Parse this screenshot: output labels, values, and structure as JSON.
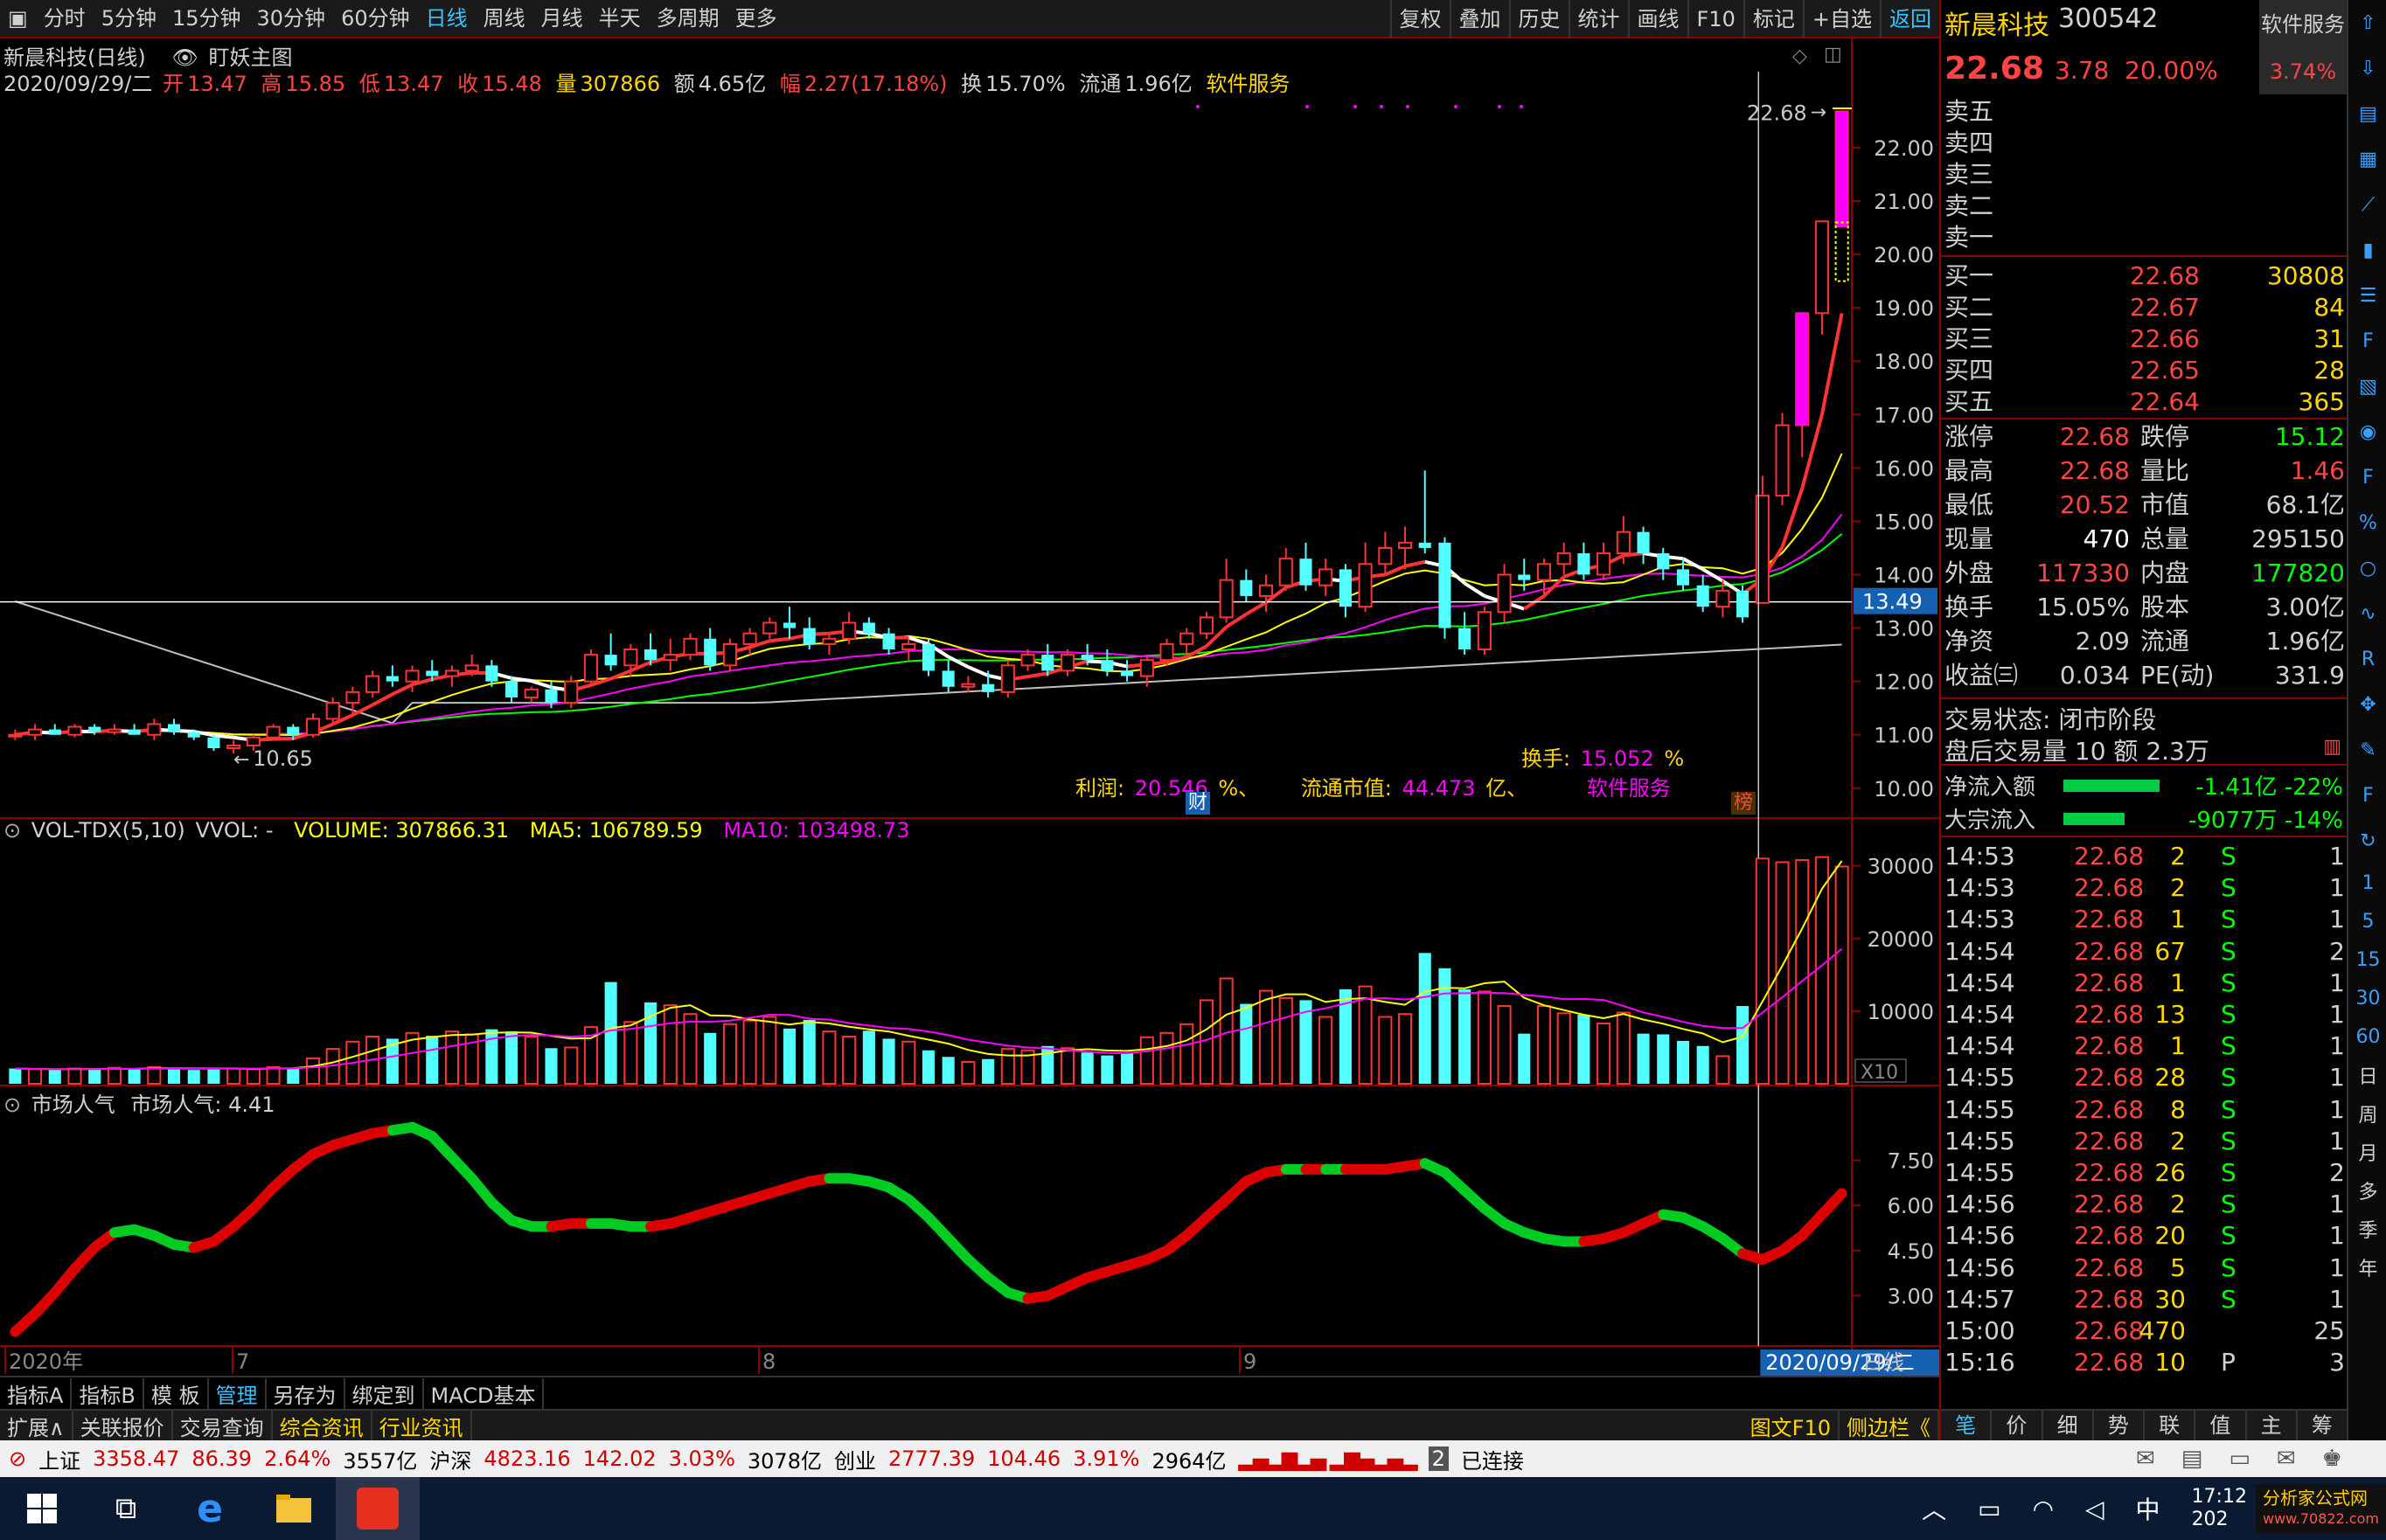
{
  "toolbar": {
    "left_items": [
      "分时",
      "5分钟",
      "15分钟",
      "30分钟",
      "60分钟",
      "日线",
      "周线",
      "月线",
      "半天",
      "多周期",
      "更多"
    ],
    "active": "日线",
    "right_items": [
      "复权",
      "叠加",
      "历史",
      "统计",
      "画线",
      "F10",
      "标记",
      "+自选",
      "返回"
    ]
  },
  "chart": {
    "title": "新晨科技(日线)",
    "indicator_name": "盯妖主图",
    "date_line": "2020/09/29/二",
    "open_label": "开",
    "open": "13.47",
    "high_label": "高",
    "high": "15.85",
    "low_label": "低",
    "low": "13.47",
    "close_label": "收",
    "close": "15.48",
    "vol_label": "量",
    "vol": "307866",
    "amt_label": "额",
    "amt": "4.65亿",
    "range_label": "幅",
    "range": "2.27(17.18%)",
    "turnover_label": "换",
    "turnover": "15.70%",
    "float_label": "流通",
    "float": "1.96亿",
    "sector": "软件服务",
    "price_peak": "22.68",
    "price_low_marker": "10.65",
    "current_line_label": "13.49",
    "y_ticks": [
      "22.00",
      "21.00",
      "20.00",
      "19.00",
      "18.00",
      "17.00",
      "16.00",
      "15.00",
      "14.00",
      "13.00",
      "12.00",
      "11.00",
      "10.00"
    ],
    "bottom_text": {
      "turnover_label": "换手:",
      "turnover_val": "15.052",
      "turnover_unit": "%",
      "profit_label": "利润:",
      "profit_val": "20.546",
      "profit_unit": "%、",
      "mktcap_label": "流通市值:",
      "mktcap_val": "44.473",
      "mktcap_unit": "亿、",
      "sector": "软件服务",
      "cai": "财",
      "bang": "榜"
    }
  },
  "vol_panel": {
    "name": "VOL-TDX(5,10)",
    "vvol": "VVOL: -",
    "volume": "VOLUME: 307866.31",
    "ma5": "MA5: 106789.59",
    "ma10": "MA10: 103498.73",
    "y_ticks": [
      "30000",
      "20000",
      "10000"
    ],
    "x10": "X10"
  },
  "sentiment_panel": {
    "name": "市场人气",
    "value": "市场人气: 4.41",
    "y_ticks": [
      "7.50",
      "6.00",
      "4.50",
      "3.00"
    ]
  },
  "x_axis": {
    "labels": [
      "2020年",
      "7",
      "8",
      "9"
    ],
    "cursor_date": "2020/09/29/二",
    "period": "日线"
  },
  "right_panel": {
    "stock_name": "新晨科技",
    "code": "300542",
    "sector_btn": "软件服务",
    "sector_pct": "3.74%",
    "price": "22.68",
    "change": "3.78",
    "change_pct": "20.00%",
    "sell": [
      {
        "label": "卖五",
        "price": "",
        "vol": ""
      },
      {
        "label": "卖四",
        "price": "",
        "vol": ""
      },
      {
        "label": "卖三",
        "price": "",
        "vol": ""
      },
      {
        "label": "卖二",
        "price": "",
        "vol": ""
      },
      {
        "label": "卖一",
        "price": "",
        "vol": ""
      }
    ],
    "buy": [
      {
        "label": "买一",
        "price": "22.68",
        "vol": "30808"
      },
      {
        "label": "买二",
        "price": "22.67",
        "vol": "84"
      },
      {
        "label": "买三",
        "price": "22.66",
        "vol": "31"
      },
      {
        "label": "买四",
        "price": "22.65",
        "vol": "28"
      },
      {
        "label": "买五",
        "price": "22.64",
        "vol": "365"
      }
    ],
    "stats": [
      {
        "l1": "涨停",
        "v1": "22.68",
        "l2": "跌停",
        "v2": "15.12",
        "c1": "#ff4444",
        "c2": "#00ff00"
      },
      {
        "l1": "最高",
        "v1": "22.68",
        "l2": "量比",
        "v2": "1.46",
        "c1": "#ff4444",
        "c2": "#ff4444"
      },
      {
        "l1": "最低",
        "v1": "20.52",
        "l2": "市值",
        "v2": "68.1亿",
        "c1": "#ff4444",
        "c2": "#d0d0d0"
      },
      {
        "l1": "现量",
        "v1": "470",
        "l2": "总量",
        "v2": "295150",
        "c1": "#ffffff",
        "c2": "#d0d0d0"
      },
      {
        "l1": "外盘",
        "v1": "117330",
        "l2": "内盘",
        "v2": "177820",
        "c1": "#ff4444",
        "c2": "#00ff00"
      },
      {
        "l1": "换手",
        "v1": "15.05%",
        "l2": "股本",
        "v2": "3.00亿",
        "c1": "#d0d0d0",
        "c2": "#d0d0d0"
      },
      {
        "l1": "净资",
        "v1": "2.09",
        "l2": "流通",
        "v2": "1.96亿",
        "c1": "#d0d0d0",
        "c2": "#d0d0d0"
      },
      {
        "l1": "收益㈢",
        "v1": "0.034",
        "l2": "PE(动)",
        "v2": "331.9",
        "c1": "#d0d0d0",
        "c2": "#d0d0d0"
      }
    ],
    "trade_state": "交易状态: 闭市阶段",
    "after_hours": "盘后交易量 10 额 2.3万",
    "net_inflow_label": "净流入额",
    "net_inflow_val": "-1.41亿 -22%",
    "block_inflow_label": "大宗流入",
    "block_inflow_val": "-9077万 -14%",
    "ticks": [
      {
        "t": "14:53",
        "p": "22.68",
        "v": "2",
        "s": "S",
        "n": "1"
      },
      {
        "t": "14:53",
        "p": "22.68",
        "v": "2",
        "s": "S",
        "n": "1"
      },
      {
        "t": "14:53",
        "p": "22.68",
        "v": "1",
        "s": "S",
        "n": "1"
      },
      {
        "t": "14:54",
        "p": "22.68",
        "v": "67",
        "s": "S",
        "n": "2"
      },
      {
        "t": "14:54",
        "p": "22.68",
        "v": "1",
        "s": "S",
        "n": "1"
      },
      {
        "t": "14:54",
        "p": "22.68",
        "v": "13",
        "s": "S",
        "n": "1"
      },
      {
        "t": "14:54",
        "p": "22.68",
        "v": "1",
        "s": "S",
        "n": "1"
      },
      {
        "t": "14:55",
        "p": "22.68",
        "v": "28",
        "s": "S",
        "n": "1"
      },
      {
        "t": "14:55",
        "p": "22.68",
        "v": "8",
        "s": "S",
        "n": "1"
      },
      {
        "t": "14:55",
        "p": "22.68",
        "v": "2",
        "s": "S",
        "n": "1"
      },
      {
        "t": "14:55",
        "p": "22.68",
        "v": "26",
        "s": "S",
        "n": "2"
      },
      {
        "t": "14:56",
        "p": "22.68",
        "v": "2",
        "s": "S",
        "n": "1"
      },
      {
        "t": "14:56",
        "p": "22.68",
        "v": "20",
        "s": "S",
        "n": "1"
      },
      {
        "t": "14:56",
        "p": "22.68",
        "v": "5",
        "s": "S",
        "n": "1"
      },
      {
        "t": "14:57",
        "p": "22.68",
        "v": "30",
        "s": "S",
        "n": "1"
      },
      {
        "t": "15:00",
        "p": "22.68",
        "v": "470",
        "s": "",
        "n": "25"
      },
      {
        "t": "15:16",
        "p": "22.68",
        "v": "10",
        "s": "P",
        "n": "3"
      }
    ],
    "bottom_tabs": [
      "笔",
      "价",
      "细",
      "势",
      "联",
      "值",
      "主",
      "筹"
    ]
  },
  "side_icons_text": [
    "1",
    "5",
    "15",
    "30",
    "60",
    "日",
    "周",
    "月",
    "多",
    "季",
    "年"
  ],
  "bottom_tabs1": [
    "指标A",
    "指标B",
    "模 板",
    "管理",
    "另存为",
    "绑定到",
    "MACD基本"
  ],
  "bottom_tabs1_active": "管理",
  "bottom_tabs2": [
    "扩展∧",
    "关联报价",
    "交易查询",
    "综合资讯",
    "行业资讯"
  ],
  "bottom_tabs2_right": [
    "图文F10",
    "侧边栏《"
  ],
  "status_bar": {
    "sh_label": "上证",
    "sh_val": "3358.47",
    "sh_chg": "86.39",
    "sh_pct": "2.64%",
    "sh_amt": "3557亿",
    "hs_label": "沪深",
    "hs_val": "4823.16",
    "hs_chg": "142.02",
    "hs_pct": "3.03%",
    "hs_amt": "3078亿",
    "cy_label": "创业",
    "cy_val": "2777.39",
    "cy_chg": "104.46",
    "cy_pct": "3.91%",
    "cy_amt": "2964亿",
    "conn_num": "2",
    "connected": "已连接"
  },
  "taskbar": {
    "clock_time": "17:12",
    "clock_date": "202",
    "watermark": "分析家公式网",
    "watermark_url": "www.70822.com"
  },
  "chart_data": {
    "type": "candlestick",
    "candles": [
      [
        11.0,
        11.1,
        10.9,
        11.0
      ],
      [
        11.0,
        11.2,
        10.9,
        11.1
      ],
      [
        11.1,
        11.2,
        11.0,
        11.0
      ],
      [
        11.0,
        11.2,
        10.95,
        11.15
      ],
      [
        11.15,
        11.2,
        11.0,
        11.05
      ],
      [
        11.05,
        11.2,
        11.0,
        11.1
      ],
      [
        11.1,
        11.2,
        11.0,
        11.0
      ],
      [
        11.0,
        11.3,
        10.9,
        11.2
      ],
      [
        11.2,
        11.3,
        11.0,
        11.05
      ],
      [
        11.05,
        11.1,
        10.9,
        10.95
      ],
      [
        10.95,
        11.0,
        10.7,
        10.75
      ],
      [
        10.75,
        10.9,
        10.65,
        10.8
      ],
      [
        10.8,
        11.0,
        10.7,
        10.95
      ],
      [
        10.95,
        11.2,
        10.9,
        11.15
      ],
      [
        11.15,
        11.2,
        10.9,
        11.0
      ],
      [
        11.0,
        11.4,
        10.95,
        11.3
      ],
      [
        11.3,
        11.7,
        11.2,
        11.6
      ],
      [
        11.6,
        11.9,
        11.4,
        11.8
      ],
      [
        11.8,
        12.2,
        11.7,
        12.1
      ],
      [
        12.1,
        12.3,
        11.9,
        12.0
      ],
      [
        12.0,
        12.3,
        11.8,
        12.2
      ],
      [
        12.2,
        12.4,
        12.0,
        12.1
      ],
      [
        12.1,
        12.3,
        11.9,
        12.2
      ],
      [
        12.2,
        12.5,
        12.1,
        12.3
      ],
      [
        12.3,
        12.4,
        11.9,
        12.0
      ],
      [
        12.0,
        12.1,
        11.6,
        11.7
      ],
      [
        11.7,
        11.9,
        11.6,
        11.85
      ],
      [
        11.85,
        12.0,
        11.5,
        11.6
      ],
      [
        11.6,
        12.1,
        11.5,
        12.0
      ],
      [
        12.0,
        12.6,
        11.9,
        12.5
      ],
      [
        12.5,
        12.9,
        12.2,
        12.3
      ],
      [
        12.3,
        12.7,
        12.1,
        12.6
      ],
      [
        12.6,
        12.9,
        12.3,
        12.4
      ],
      [
        12.4,
        12.8,
        12.2,
        12.5
      ],
      [
        12.5,
        12.9,
        12.4,
        12.8
      ],
      [
        12.8,
        13.0,
        12.2,
        12.3
      ],
      [
        12.3,
        12.8,
        12.2,
        12.7
      ],
      [
        12.7,
        13.0,
        12.5,
        12.9
      ],
      [
        12.9,
        13.2,
        12.8,
        13.1
      ],
      [
        13.1,
        13.4,
        12.8,
        13.0
      ],
      [
        13.0,
        13.2,
        12.6,
        12.7
      ],
      [
        12.7,
        12.9,
        12.5,
        12.8
      ],
      [
        12.8,
        13.3,
        12.7,
        13.1
      ],
      [
        13.1,
        13.2,
        12.8,
        12.9
      ],
      [
        12.9,
        13.0,
        12.5,
        12.6
      ],
      [
        12.6,
        12.8,
        12.4,
        12.7
      ],
      [
        12.7,
        12.8,
        12.1,
        12.2
      ],
      [
        12.2,
        12.4,
        11.8,
        11.9
      ],
      [
        11.9,
        12.1,
        11.8,
        11.95
      ],
      [
        11.95,
        12.2,
        11.7,
        11.8
      ],
      [
        11.8,
        12.4,
        11.7,
        12.3
      ],
      [
        12.3,
        12.6,
        12.2,
        12.5
      ],
      [
        12.5,
        12.7,
        12.1,
        12.2
      ],
      [
        12.2,
        12.6,
        12.1,
        12.5
      ],
      [
        12.5,
        12.7,
        12.3,
        12.4
      ],
      [
        12.4,
        12.6,
        12.1,
        12.2
      ],
      [
        12.2,
        12.4,
        12.0,
        12.1
      ],
      [
        12.1,
        12.5,
        11.9,
        12.4
      ],
      [
        12.4,
        12.8,
        12.3,
        12.7
      ],
      [
        12.7,
        13.0,
        12.5,
        12.9
      ],
      [
        12.9,
        13.3,
        12.8,
        13.2
      ],
      [
        13.2,
        14.3,
        13.1,
        13.9
      ],
      [
        13.9,
        14.1,
        13.5,
        13.6
      ],
      [
        13.6,
        14.0,
        13.3,
        13.8
      ],
      [
        13.8,
        14.5,
        13.7,
        14.3
      ],
      [
        14.3,
        14.6,
        13.7,
        13.8
      ],
      [
        13.8,
        14.3,
        13.6,
        14.1
      ],
      [
        14.1,
        14.2,
        13.2,
        13.4
      ],
      [
        13.4,
        14.6,
        13.3,
        14.2
      ],
      [
        14.2,
        14.8,
        14.0,
        14.5
      ],
      [
        14.5,
        14.9,
        14.1,
        14.6
      ],
      [
        14.6,
        15.95,
        14.4,
        14.5
      ],
      [
        14.6,
        14.7,
        12.8,
        13.0
      ],
      [
        13.0,
        13.3,
        12.5,
        12.6
      ],
      [
        12.6,
        13.4,
        12.5,
        13.3
      ],
      [
        13.3,
        14.2,
        13.1,
        14.0
      ],
      [
        14.0,
        14.3,
        13.7,
        13.9
      ],
      [
        13.9,
        14.3,
        13.6,
        14.2
      ],
      [
        14.2,
        14.6,
        14.0,
        14.4
      ],
      [
        14.4,
        14.6,
        13.9,
        14.0
      ],
      [
        14.0,
        14.6,
        13.9,
        14.4
      ],
      [
        14.4,
        15.1,
        14.2,
        14.8
      ],
      [
        14.8,
        14.9,
        14.2,
        14.4
      ],
      [
        14.4,
        14.5,
        13.9,
        14.1
      ],
      [
        14.1,
        14.3,
        13.7,
        13.8
      ],
      [
        13.8,
        14.0,
        13.3,
        13.4
      ],
      [
        13.4,
        13.9,
        13.2,
        13.7
      ],
      [
        13.7,
        13.8,
        13.1,
        13.2
      ],
      [
        13.47,
        15.85,
        13.47,
        15.48
      ],
      [
        15.48,
        17.03,
        15.3,
        16.8
      ],
      [
        16.8,
        18.9,
        16.2,
        18.9
      ],
      [
        18.9,
        20.62,
        18.5,
        20.62
      ],
      [
        20.52,
        22.68,
        20.52,
        22.68
      ]
    ],
    "volumes": [
      2100,
      2000,
      1900,
      2100,
      2000,
      2200,
      2100,
      2300,
      2000,
      1900,
      2200,
      2100,
      2000,
      2300,
      2100,
      3500,
      4800,
      5800,
      6500,
      6200,
      7000,
      6600,
      7200,
      6800,
      7500,
      7200,
      6500,
      4900,
      5000,
      7800,
      14000,
      8500,
      11200,
      10800,
      9600,
      7000,
      8200,
      8700,
      9200,
      7600,
      8800,
      7200,
      6500,
      7300,
      6200,
      5800,
      4600,
      3700,
      3000,
      3400,
      4800,
      4600,
      5200,
      4900,
      4300,
      3900,
      4300,
      6400,
      7000,
      8200,
      11500,
      14500,
      11000,
      12800,
      11800,
      11500,
      9200,
      13000,
      13400,
      9200,
      9600,
      18000,
      15900,
      13000,
      12700,
      10700,
      6900,
      10700,
      9700,
      9500,
      8300,
      9800,
      6900,
      6800,
      5900,
      5200,
      3800,
      10700,
      31000,
      30500,
      30800,
      31200,
      29900
    ],
    "vol_up": [
      false,
      true,
      false,
      true,
      false,
      true,
      false,
      true,
      false,
      false,
      false,
      true,
      true,
      true,
      false,
      true,
      true,
      true,
      true,
      false,
      true,
      false,
      true,
      true,
      false,
      false,
      true,
      false,
      true,
      true,
      false,
      true,
      false,
      true,
      true,
      false,
      true,
      true,
      true,
      false,
      false,
      true,
      true,
      false,
      false,
      true,
      false,
      false,
      true,
      false,
      true,
      true,
      false,
      true,
      false,
      false,
      false,
      true,
      true,
      true,
      true,
      true,
      false,
      true,
      true,
      false,
      true,
      false,
      true,
      true,
      true,
      false,
      false,
      false,
      true,
      true,
      false,
      true,
      true,
      false,
      true,
      true,
      false,
      false,
      false,
      false,
      true,
      false,
      true,
      true,
      true,
      true,
      true
    ],
    "vol_ylim": [
      0,
      32000
    ],
    "ylim": [
      9.8,
      22.9
    ],
    "sentiment": [
      1.8,
      2.4,
      3.1,
      3.9,
      4.6,
      5.1,
      5.2,
      5.0,
      4.7,
      4.6,
      4.8,
      5.3,
      5.9,
      6.6,
      7.2,
      7.7,
      8.0,
      8.2,
      8.4,
      8.5,
      8.6,
      8.3,
      7.6,
      6.9,
      6.1,
      5.5,
      5.3,
      5.3,
      5.4,
      5.4,
      5.4,
      5.3,
      5.3,
      5.4,
      5.6,
      5.8,
      6.0,
      6.2,
      6.4,
      6.6,
      6.8,
      6.9,
      6.9,
      6.8,
      6.6,
      6.2,
      5.6,
      4.9,
      4.2,
      3.6,
      3.1,
      2.9,
      3.0,
      3.3,
      3.6,
      3.8,
      4.0,
      4.2,
      4.5,
      5.0,
      5.6,
      6.2,
      6.8,
      7.1,
      7.2,
      7.2,
      7.2,
      7.2,
      7.2,
      7.2,
      7.3,
      7.4,
      7.1,
      6.5,
      5.9,
      5.4,
      5.1,
      4.9,
      4.8,
      4.8,
      4.9,
      5.1,
      5.4,
      5.7,
      5.6,
      5.3,
      4.9,
      4.4,
      4.2,
      4.5,
      5.0,
      5.7,
      6.4
    ],
    "sentiment_up": [
      true,
      true,
      true,
      true,
      true,
      true,
      false,
      false,
      false,
      false,
      true,
      true,
      true,
      true,
      true,
      true,
      true,
      true,
      true,
      true,
      false,
      false,
      false,
      false,
      false,
      false,
      false,
      false,
      true,
      true,
      false,
      false,
      false,
      true,
      true,
      true,
      true,
      true,
      true,
      true,
      true,
      true,
      false,
      false,
      false,
      false,
      false,
      false,
      false,
      false,
      false,
      false,
      true,
      true,
      true,
      true,
      true,
      true,
      true,
      true,
      true,
      true,
      true,
      true,
      true,
      false,
      true,
      false,
      true,
      true,
      true,
      true,
      false,
      false,
      false,
      false,
      false,
      false,
      false,
      false,
      true,
      true,
      true,
      true,
      false,
      false,
      false,
      false,
      true,
      true,
      true,
      true,
      true
    ],
    "sentiment_ylim": [
      1.5,
      9.0
    ]
  },
  "colors": {
    "up": "#ff3333",
    "down": "#54ffff",
    "ma_white": "#ffffff",
    "ma_yellow": "#ffff00",
    "ma_magenta": "#ff00ff",
    "ma_green": "#00ff00",
    "ma_gray": "#c0c0c0",
    "grid_red": "#8b0000"
  }
}
